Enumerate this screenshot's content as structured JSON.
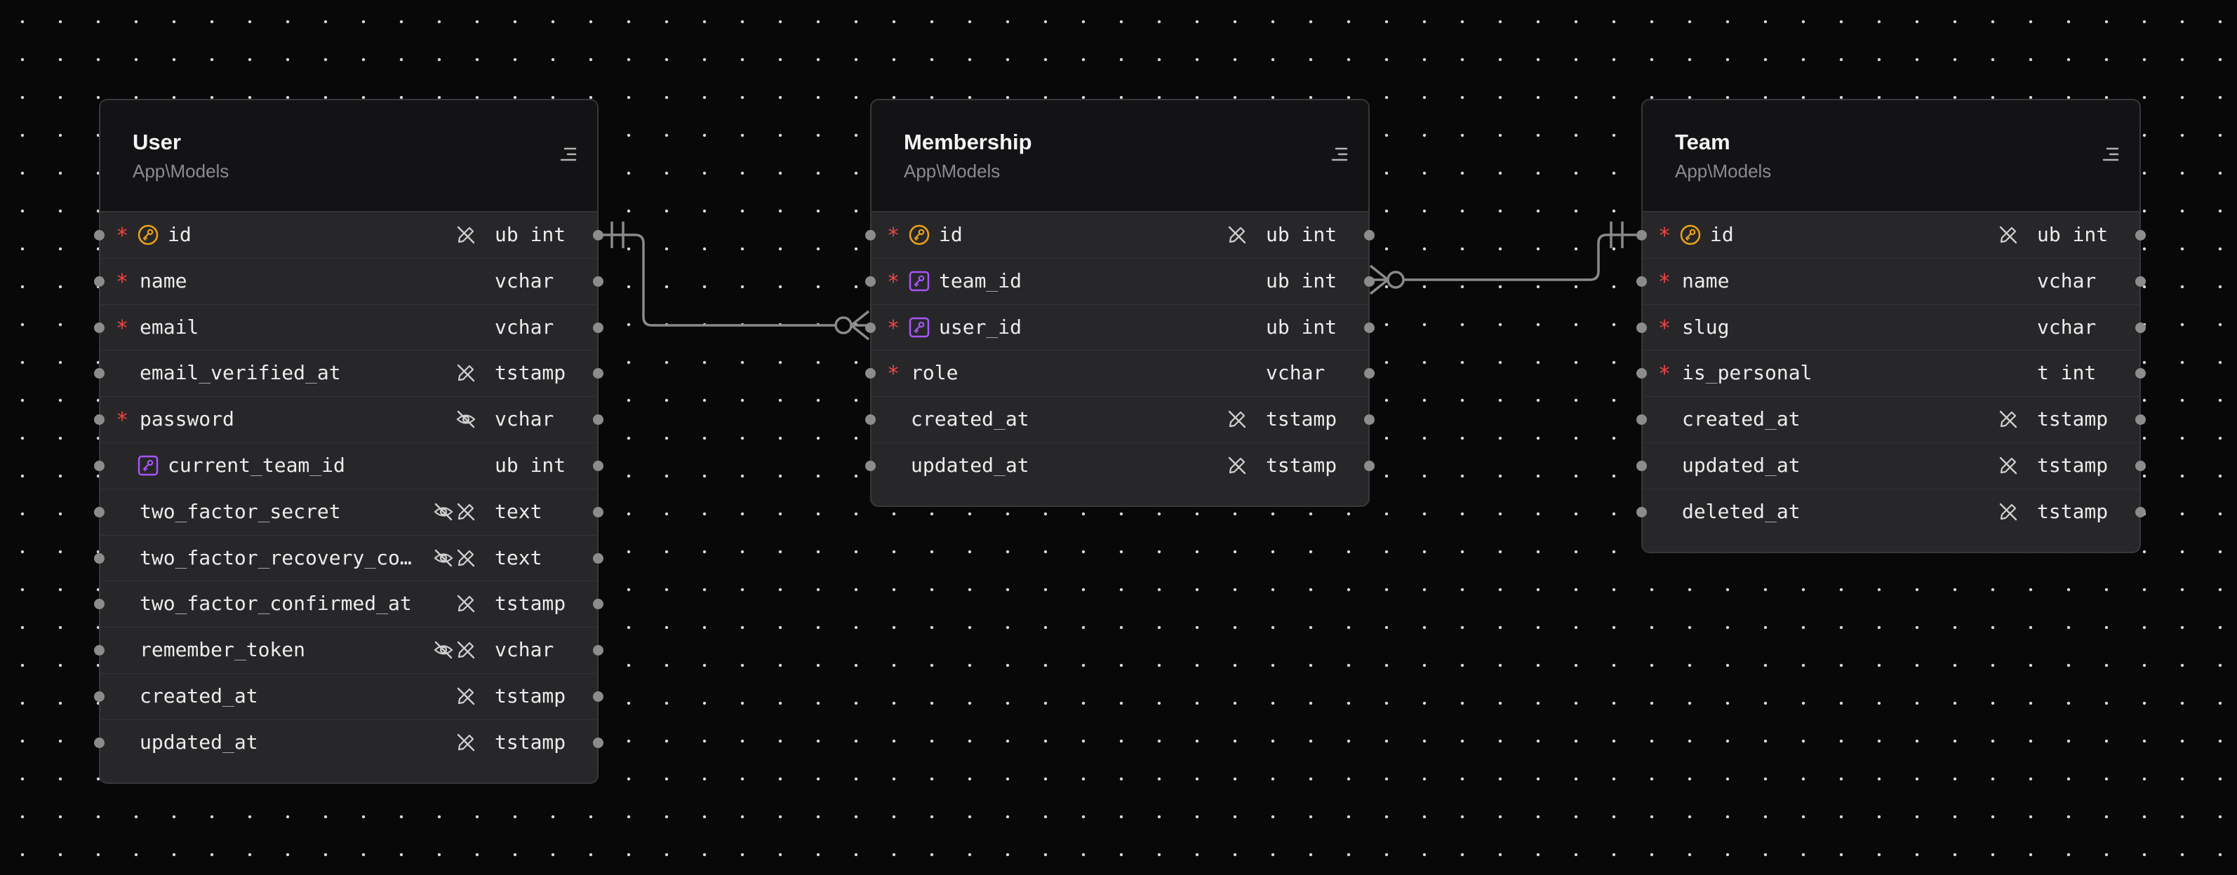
{
  "colors": {
    "required": "#ef4444",
    "primary_key": "#e9a21a",
    "foreign_key": "#a855f7",
    "edge": "#8a8a8a"
  },
  "tables": [
    {
      "id": "user",
      "name": "User",
      "namespace": "App\\Models",
      "columns": [
        {
          "name": "id",
          "type": "ub int",
          "required": true,
          "key": "primary",
          "flags": [
            "no-edit"
          ]
        },
        {
          "name": "name",
          "type": "vchar",
          "required": true,
          "key": null,
          "flags": []
        },
        {
          "name": "email",
          "type": "vchar",
          "required": true,
          "key": null,
          "flags": []
        },
        {
          "name": "email_verified_at",
          "type": "tstamp",
          "required": false,
          "key": null,
          "flags": [
            "no-edit"
          ]
        },
        {
          "name": "password",
          "type": "vchar",
          "required": true,
          "key": null,
          "flags": [
            "hidden"
          ]
        },
        {
          "name": "current_team_id",
          "type": "ub int",
          "required": false,
          "key": "foreign",
          "flags": []
        },
        {
          "name": "two_factor_secret",
          "type": "text",
          "required": false,
          "key": null,
          "flags": [
            "hidden",
            "no-edit"
          ]
        },
        {
          "name": "two_factor_recovery_cod…",
          "type": "text",
          "required": false,
          "key": null,
          "flags": [
            "hidden",
            "no-edit"
          ]
        },
        {
          "name": "two_factor_confirmed_at",
          "type": "tstamp",
          "required": false,
          "key": null,
          "flags": [
            "no-edit"
          ]
        },
        {
          "name": "remember_token",
          "type": "vchar",
          "required": false,
          "key": null,
          "flags": [
            "hidden",
            "no-edit"
          ]
        },
        {
          "name": "created_at",
          "type": "tstamp",
          "required": false,
          "key": null,
          "flags": [
            "no-edit"
          ]
        },
        {
          "name": "updated_at",
          "type": "tstamp",
          "required": false,
          "key": null,
          "flags": [
            "no-edit"
          ]
        }
      ]
    },
    {
      "id": "membership",
      "name": "Membership",
      "namespace": "App\\Models",
      "columns": [
        {
          "name": "id",
          "type": "ub int",
          "required": true,
          "key": "primary",
          "flags": [
            "no-edit"
          ]
        },
        {
          "name": "team_id",
          "type": "ub int",
          "required": true,
          "key": "foreign",
          "flags": []
        },
        {
          "name": "user_id",
          "type": "ub int",
          "required": true,
          "key": "foreign",
          "flags": []
        },
        {
          "name": "role",
          "type": "vchar",
          "required": true,
          "key": null,
          "flags": []
        },
        {
          "name": "created_at",
          "type": "tstamp",
          "required": false,
          "key": null,
          "flags": [
            "no-edit"
          ]
        },
        {
          "name": "updated_at",
          "type": "tstamp",
          "required": false,
          "key": null,
          "flags": [
            "no-edit"
          ]
        }
      ]
    },
    {
      "id": "team",
      "name": "Team",
      "namespace": "App\\Models",
      "columns": [
        {
          "name": "id",
          "type": "ub int",
          "required": true,
          "key": "primary",
          "flags": [
            "no-edit"
          ]
        },
        {
          "name": "name",
          "type": "vchar",
          "required": true,
          "key": null,
          "flags": []
        },
        {
          "name": "slug",
          "type": "vchar",
          "required": true,
          "key": null,
          "flags": []
        },
        {
          "name": "is_personal",
          "type": "t int",
          "required": true,
          "key": null,
          "flags": []
        },
        {
          "name": "created_at",
          "type": "tstamp",
          "required": false,
          "key": null,
          "flags": [
            "no-edit"
          ]
        },
        {
          "name": "updated_at",
          "type": "tstamp",
          "required": false,
          "key": null,
          "flags": [
            "no-edit"
          ]
        },
        {
          "name": "deleted_at",
          "type": "tstamp",
          "required": false,
          "key": null,
          "flags": [
            "no-edit"
          ]
        }
      ]
    }
  ],
  "relations": [
    {
      "from_table": "user",
      "from_column": "id",
      "from_cardinality": "one",
      "to_table": "membership",
      "to_column": "user_id",
      "to_cardinality": "zero-or-many"
    },
    {
      "from_table": "team",
      "from_column": "id",
      "from_cardinality": "one",
      "to_table": "membership",
      "to_column": "team_id",
      "to_cardinality": "zero-or-many"
    }
  ]
}
